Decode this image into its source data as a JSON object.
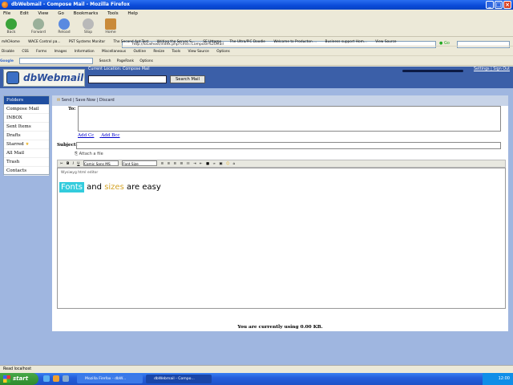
{
  "window": {
    "title": "dbWebmail - Compose Mail - Mozilla Firefox"
  },
  "menu": [
    "File",
    "Edit",
    "View",
    "Go",
    "Bookmarks",
    "Tools",
    "Help"
  ],
  "nav": {
    "back": "Back",
    "forward": "Forward",
    "reload": "Reload",
    "stop": "Stop",
    "home": "Home",
    "go": "Go"
  },
  "url": "http://localhost/index.php?cmd=Compose%20Mail",
  "bookmarks": [
    "mACHome",
    "WACE Control pa...",
    "PST Systems Monitor",
    "The Second Apt Test",
    "Writing the Server S...",
    "SE Uttamo",
    "The Ultra/PiC Doodle",
    "Welcome to Producton ...",
    "Business support Hom...",
    "View Source"
  ],
  "toolbar2": [
    "Disable",
    "CSS",
    "Forms",
    "Images",
    "Information",
    "Miscellaneous",
    "Outline",
    "Resize",
    "Tools",
    "View Source",
    "Options"
  ],
  "google_bar": {
    "label": "Google",
    "items": [
      "Search",
      "PageRank",
      "Options"
    ]
  },
  "app": {
    "logo": "dbWebmail",
    "current_location": "Current Location: Compose Mail",
    "search_button": "Search Mail",
    "links": "Settings | Sign Out"
  },
  "sidebar": {
    "items": [
      "Folders",
      "Compose Mail",
      "INBOX",
      "Sent Items",
      "Drafts",
      "Starred",
      "All Mail",
      "Trash",
      "Contacts"
    ]
  },
  "compose": {
    "toolbar": "Send | Save Now | Discard",
    "to_label": "To:",
    "add_cc": "Add Cc",
    "add_bcc": "Add Bcc",
    "subject_label": "Subject:",
    "attach": "Attach a file",
    "editor_hint": "Wysiwyg html editor",
    "font_select": "Comic Sans MS",
    "size_select": "Font Size",
    "body_words": [
      "Fonts",
      "and",
      "sizes",
      "are easy"
    ]
  },
  "usage": "You are currently using 0.00 KB.",
  "status": "Read localhost",
  "taskbar": {
    "start": "start",
    "tasks": [
      "Mozilla Firefox - dbW...",
      "dbWebmail - Compo..."
    ],
    "clock": "12:00"
  },
  "colors": {
    "header": "#3b5fa8",
    "panel_bg": "#9fb6e0",
    "highlight": "#33ccdd",
    "sizes_text": "#d4a428"
  }
}
